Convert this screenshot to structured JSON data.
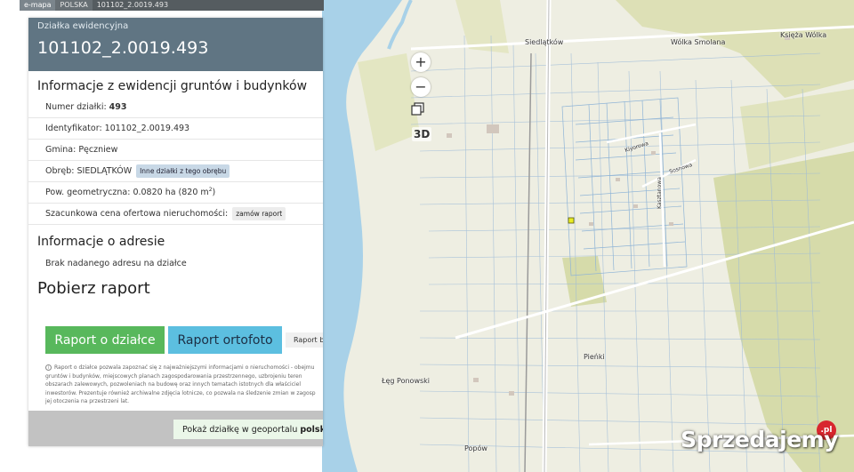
{
  "breadcrumb": {
    "items": [
      "e-mapa",
      "POLSKA",
      "101102_2.0019.493"
    ]
  },
  "panel": {
    "subtitle": "Działka ewidencyjna",
    "title": "101102_2.0019.493",
    "section_egib": "Informacje z ewidencji gruntów i budynków",
    "rows": {
      "numer_label": "Numer działki:",
      "numer_value": "493",
      "identyfikator_label": "Identyfikator:",
      "identyfikator_value": "101102_2.0019.493",
      "gmina_label": "Gmina:",
      "gmina_value": "Pęczniew",
      "obreb_label": "Obręb:",
      "obreb_value": "SIEDLĄTKÓW",
      "obreb_button": "Inne działki z tego obrębu",
      "pow_label": "Pow. geometryczna:",
      "pow_value": "0.0820 ha (820 m",
      "pow_sup": "2",
      "pow_close": ")",
      "cena_label": "Szacunkowa cena ofertowa nieruchomości:",
      "cena_button": "zamów raport"
    },
    "section_adres": "Informacje o adresie",
    "adres_text": "Brak nadanego adresu na działce",
    "section_raport": "Pobierz raport",
    "btn_raport_dzialka": "Raport o działce",
    "btn_raport_ortofoto": "Raport ortofoto",
    "btn_raport_small": "Raport be",
    "note_text": "Raport o działce pozwala zapoznać się z najważniejszymi informacjami o nieruchomości - obejmu gruntów i budynków, miejscowych planach zagospodarowania przestrzennego, uzbrojeniu teren obszarach zalewowych, pozwoleniach na budowę oraz innych tematach istotnych dla właściciel inwestorów. Prezentuje również archiwalne zdjęcia lotnicze, co pozwala na śledzenie zmian w zagosp jej otoczenia na przestrzeni lat.",
    "geoportal_text": "Pokaż działkę w geoportalu",
    "geoportal_bold": "polska"
  },
  "map": {
    "zoom_in": "+",
    "zoom_out": "−",
    "layers_icon": "layers-icon",
    "btn_3d": "3D",
    "places": {
      "siedlatkow": "Siedlątków",
      "wolka_smolana": "Wólka Smolana",
      "ksiezna_wolka": "Księża Wólka",
      "leg_ponowski": "Łęg Ponowski",
      "pienki": "Pieńki",
      "popow": "Popów",
      "street1": "Kiyorowa",
      "street2": "Sosnowa",
      "street3": "Kasztanowa"
    },
    "colors": {
      "water": "#a8d1e8",
      "forest": "#d8dcae",
      "background": "#eeeee2",
      "parcel_line": "#8fb4d6",
      "selected_parcel": "#e8ec23"
    }
  },
  "watermark": {
    "text": "Sprzedajemy",
    "badge": ".pl"
  }
}
